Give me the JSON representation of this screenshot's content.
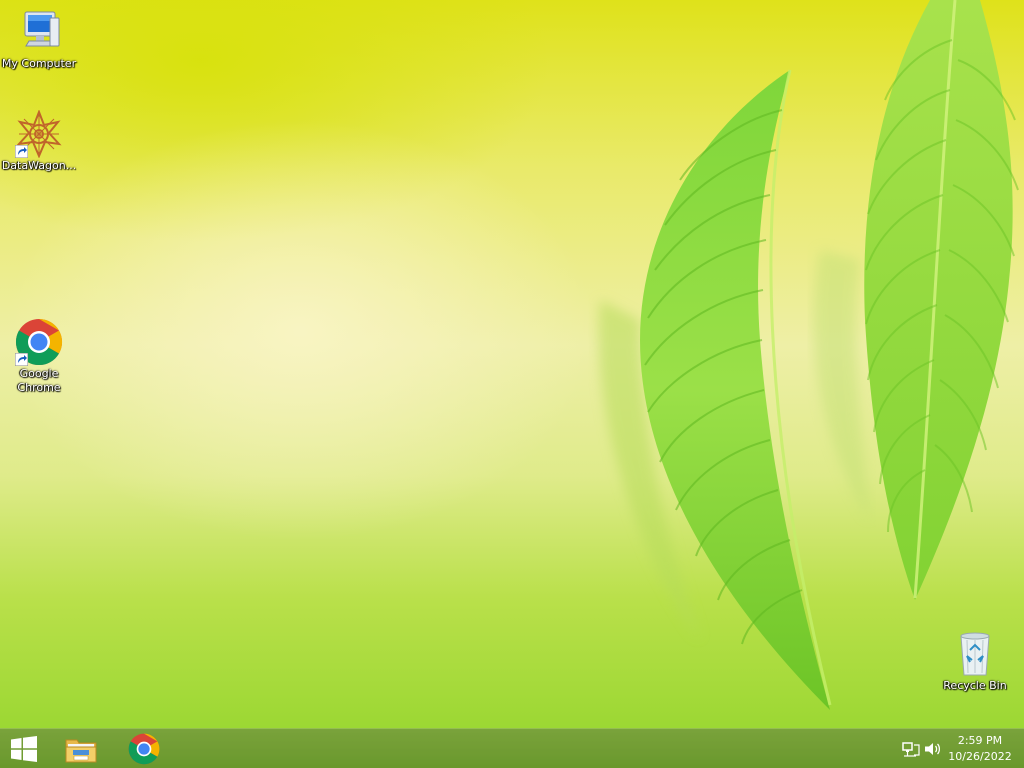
{
  "desktop": {
    "icons": [
      {
        "label": "My Computer",
        "icon": "computer-icon"
      },
      {
        "label": "DataWagon...",
        "icon": "datawagon-icon"
      },
      {
        "label": "Google Chrome",
        "icon": "chrome-icon"
      },
      {
        "label": "Recycle Bin",
        "icon": "recycle-bin-icon"
      }
    ]
  },
  "taskbar": {
    "buttons": [
      {
        "name": "Start",
        "icon": "windows-logo-icon"
      },
      {
        "name": "File Explorer",
        "icon": "folder-icon"
      },
      {
        "name": "Google Chrome",
        "icon": "chrome-icon"
      }
    ],
    "tray": {
      "icons": [
        "network-icon",
        "volume-icon"
      ],
      "time": "2:59 PM",
      "date": "10/26/2022"
    }
  }
}
